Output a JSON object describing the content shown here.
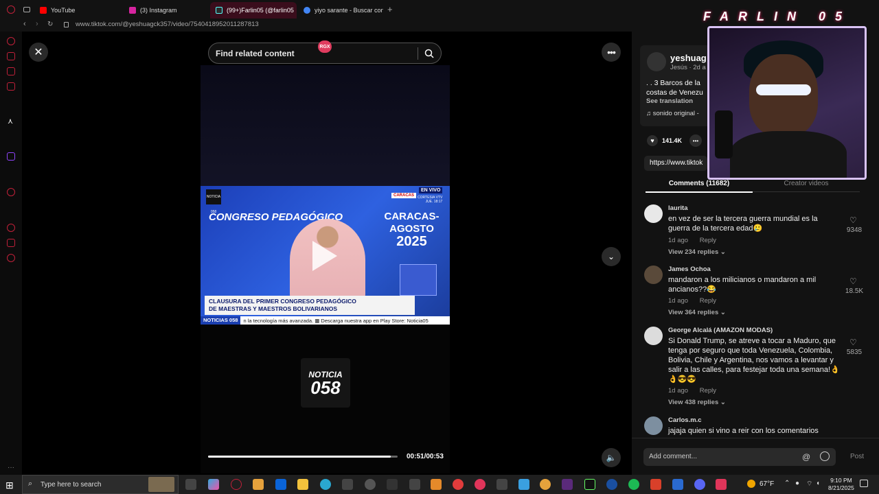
{
  "browser": {
    "tabs": [
      {
        "label": "YouTube",
        "color": "#ff0000"
      },
      {
        "label": "(3) Instagram",
        "color": "#d6249f"
      },
      {
        "label": "(99+)Farlin05 (@farlin05",
        "color": "#2b2b2b"
      },
      {
        "label": "yiyo sarante - Buscar con",
        "color": "#4285f4"
      }
    ],
    "url": "www.tiktok.com/@yeshuagck357/video/7540418952011287813"
  },
  "video": {
    "search_placeholder": "Find related content",
    "rgx_badge": "RGX",
    "frame_title_left": "CONGRESO PEDAGÓGICO",
    "frame_title_right_1": "CARACAS-AGOSTO",
    "frame_title_right_2": "2025",
    "en_vivo": "EN VIVO",
    "caracas": "CARACAS",
    "cortesia_1": "CORTESIA VTV",
    "cortesia_2": "JUE. 18:17",
    "lower_third_1": "CLAUSURA DEL PRIMER CONGRESO PEDAGÓGICO",
    "lower_third_2": "DE MAESTRAS Y MAESTROS BOLIVARIANOS",
    "logo_small": "NOTICIA 058",
    "ticker_label": "NOTICIAS 058",
    "ticker_text": "n la tecnología más avanzada.   ▦  Descarga nuestra app en Play Store: Noticia05",
    "big_logo_top": "NOTICIA",
    "big_logo_bottom": "058",
    "time": "00:51/00:53",
    "progress": 0.962
  },
  "panel": {
    "author": "yeshuag",
    "author_sub": "Jesús · 2d a",
    "description": ". . 3 Barcos de la costas de Venezu",
    "see_translation": "See translation",
    "sound": "♫  sonido original -",
    "likes": "141.4K",
    "link": "https://www.tiktok",
    "tab_comments": "Comments (11682)",
    "tab_creator": "Creator videos",
    "comments": [
      {
        "name": "laurita",
        "text": "en vez de ser la tercera guerra mundial es la guerra de la tercera edad🥲",
        "ago": "1d ago",
        "reply": "Reply",
        "replies": "View 234 replies ⌄",
        "likes": "9348"
      },
      {
        "name": "James Ochoa",
        "text": "mandaron a los milicianos o mandaron a mil ancianos??😂",
        "ago": "1d ago",
        "reply": "Reply",
        "replies": "View 364 replies ⌄",
        "likes": "18.5K"
      },
      {
        "name": "George Alcalá (AMAZON MODAS)",
        "text": "Si Donald Trump, se atreve a tocar a Maduro, que tenga por seguro que toda Venezuela, Colombia, Bolivia, Chile y Argentina, nos vamos a levantar y salir a las calles, para festejar toda una semana!👌👌😎😎",
        "ago": "1d ago",
        "reply": "Reply",
        "replies": "View 438 replies ⌄",
        "likes": "5835"
      },
      {
        "name": "Carlos.m.c",
        "text": "jajaja quien si vino a reir con los comentarios",
        "ago": "",
        "reply": "",
        "replies": "",
        "likes": ""
      }
    ],
    "add_comment_placeholder": "Add comment...",
    "at": "@",
    "post": "Post"
  },
  "webcam": {
    "title": "FARLIN 05"
  },
  "taskbar": {
    "search_placeholder": "Type here to search",
    "weather": "67°F",
    "time": "9:10 PM",
    "date": "8/21/2025"
  },
  "colors": {
    "accent": "#c2213a",
    "tiktok_pink": "#e03c5f"
  }
}
